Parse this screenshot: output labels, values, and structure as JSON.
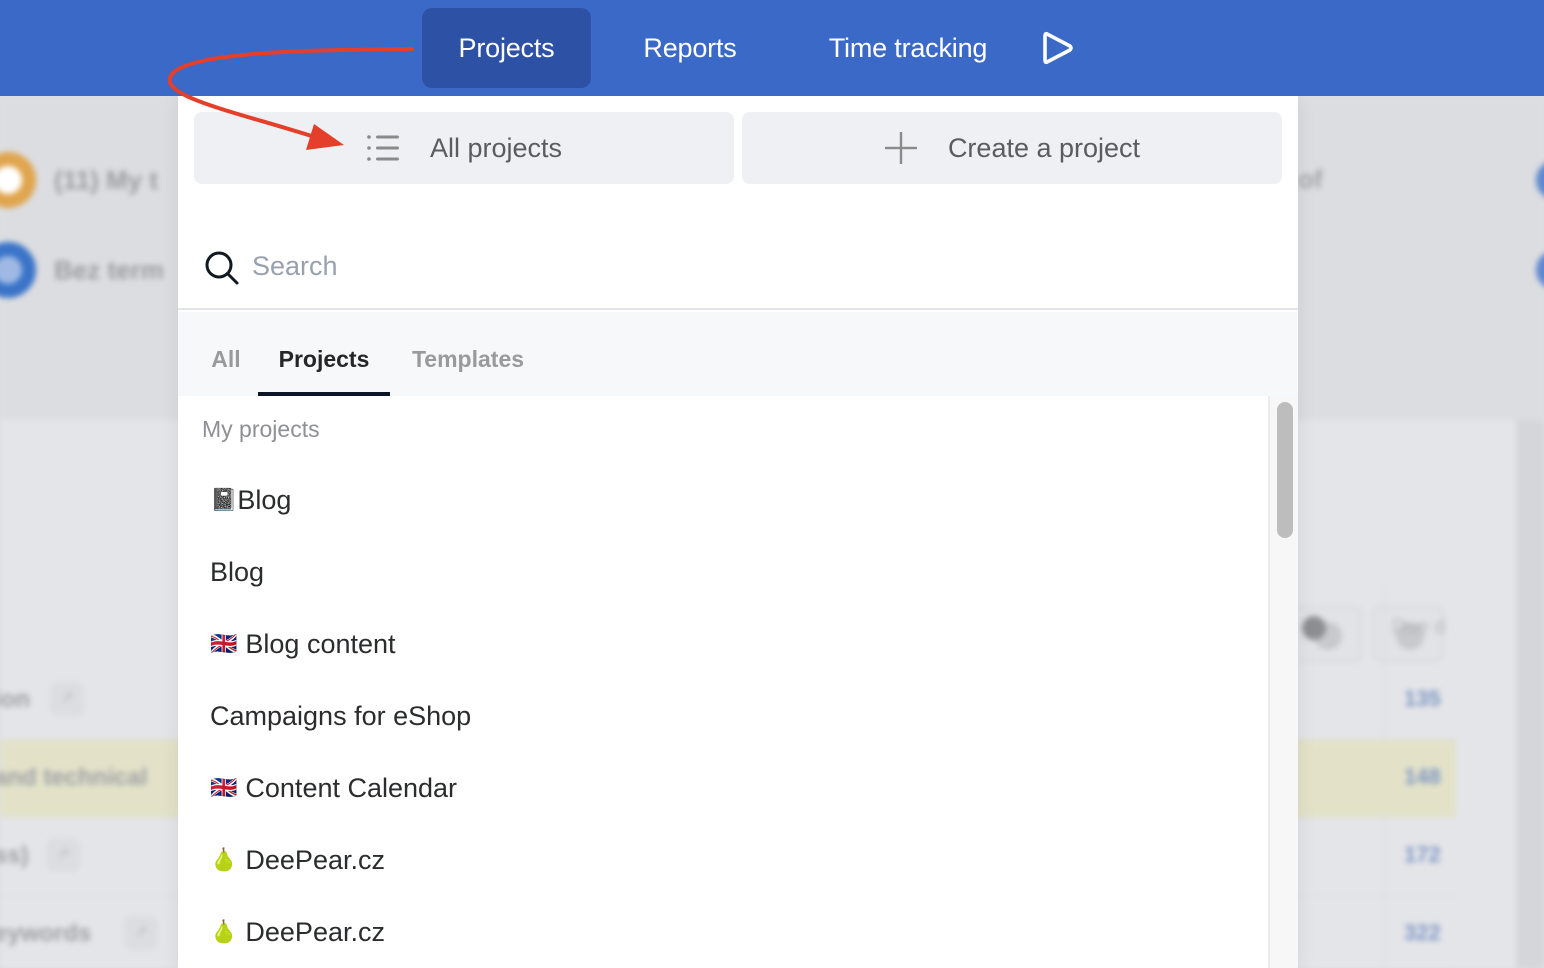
{
  "nav": {
    "items": [
      {
        "label": "Projects",
        "active": true
      },
      {
        "label": "Reports",
        "active": false
      },
      {
        "label": "Time tracking",
        "active": false
      }
    ],
    "play_icon": "play-icon",
    "colors": {
      "bar": "#3b69c7",
      "active": "#2d52a5"
    }
  },
  "dropdown": {
    "all_projects_label": "All projects",
    "create_project_label": "Create a project",
    "search": {
      "placeholder": "Search",
      "value": ""
    },
    "tabs": [
      {
        "label": "All",
        "active": false
      },
      {
        "label": "Projects",
        "active": true
      },
      {
        "label": "Templates",
        "active": false
      }
    ],
    "section_label": "My projects",
    "projects": [
      {
        "emoji": "📓",
        "name": "Blog"
      },
      {
        "emoji": "",
        "name": "Blog"
      },
      {
        "emoji": "🇬🇧",
        "name": "Blog content"
      },
      {
        "emoji": "",
        "name": "Campaigns for eShop"
      },
      {
        "emoji": "🇬🇧",
        "name": "Content Calendar"
      },
      {
        "emoji": "🍐",
        "name": "DeePear.cz"
      },
      {
        "emoji": "🍐",
        "name": "DeePear.cz"
      }
    ]
  },
  "background": {
    "filters": [
      "(11) My t",
      "Bez term"
    ],
    "rows": [
      {
        "text": "ion",
        "number": "135",
        "highlight": false
      },
      {
        "text": "and technical",
        "number": "148",
        "highlight": true
      },
      {
        "text": "ss)",
        "number": "172",
        "highlight": false
      },
      {
        "text": "eywords",
        "number": "322",
        "highlight": false
      }
    ],
    "header_due": "Due d",
    "trailing_filter": "of"
  },
  "annotation": {
    "color": "#e43f2a"
  }
}
